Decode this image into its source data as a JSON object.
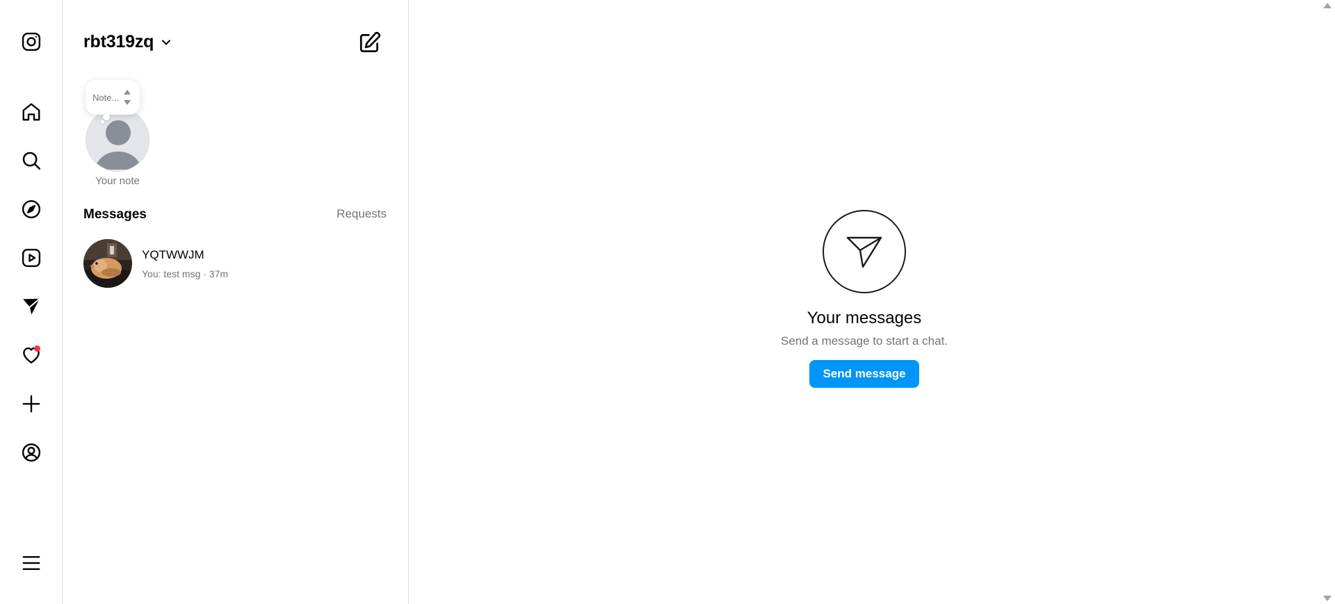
{
  "rail": {
    "icons": [
      "instagram-logo-icon",
      "home-icon",
      "search-icon",
      "compass-icon",
      "reels-icon",
      "messages-icon",
      "heart-icon",
      "create-icon",
      "profile-icon",
      "menu-icon"
    ]
  },
  "inbox": {
    "username": "rbt319zq",
    "note_placeholder": "Note...",
    "note_label": "Your note",
    "messages_title": "Messages",
    "requests_label": "Requests",
    "conversations": [
      {
        "name": "YQTWWJM",
        "preview": "You: test msg · 37m"
      }
    ]
  },
  "empty_state": {
    "title": "Your messages",
    "subtitle": "Send a message to start a chat.",
    "button_label": "Send message"
  },
  "colors": {
    "accent": "#0095f6",
    "notification": "#ff3040",
    "secondary_text": "#737373",
    "border": "#dbdbdb"
  }
}
